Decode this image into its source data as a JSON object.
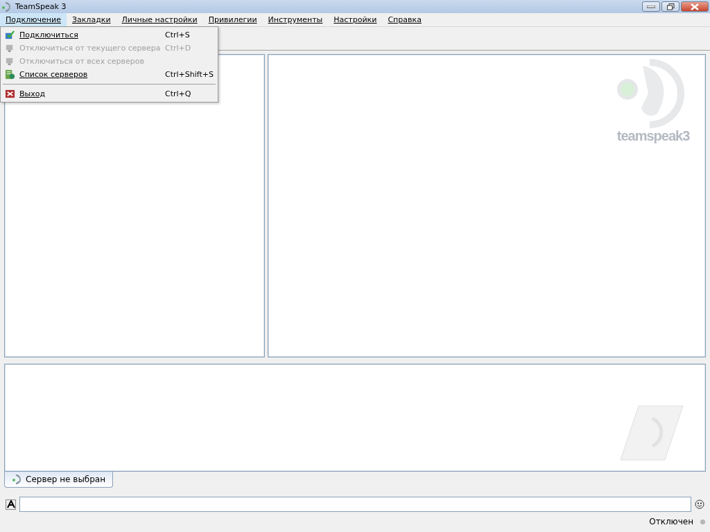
{
  "window": {
    "title": "TeamSpeak 3"
  },
  "menu_bar": [
    {
      "label": "Подключение",
      "selected": true
    },
    {
      "label": "Закладки",
      "selected": false
    },
    {
      "label": "Личные настройки",
      "selected": false
    },
    {
      "label": "Привилегии",
      "selected": false
    },
    {
      "label": "Инструменты",
      "selected": false
    },
    {
      "label": "Настройки",
      "selected": false
    },
    {
      "label": "Справка",
      "selected": false
    }
  ],
  "dropdown": [
    {
      "kind": "item",
      "label": "Подключиться",
      "shortcut": "Ctrl+S",
      "disabled": false
    },
    {
      "kind": "item",
      "label": "Отключиться от текущего сервера",
      "shortcut": "Ctrl+D",
      "disabled": true
    },
    {
      "kind": "item",
      "label": "Отключиться от всех серверов",
      "disabled": true
    },
    {
      "kind": "item",
      "label": "Список серверов",
      "shortcut": "Ctrl+Shift+S",
      "disabled": false
    },
    {
      "kind": "separator"
    },
    {
      "kind": "item",
      "label": "Выход",
      "shortcut": "Ctrl+Q",
      "disabled": false
    }
  ],
  "info_panel": {
    "logo_text": "teamspeak3"
  },
  "server_tabs": [
    {
      "label": "Сервер не выбран",
      "selected": true
    }
  ],
  "status_bar": {
    "text": "Отключен"
  }
}
